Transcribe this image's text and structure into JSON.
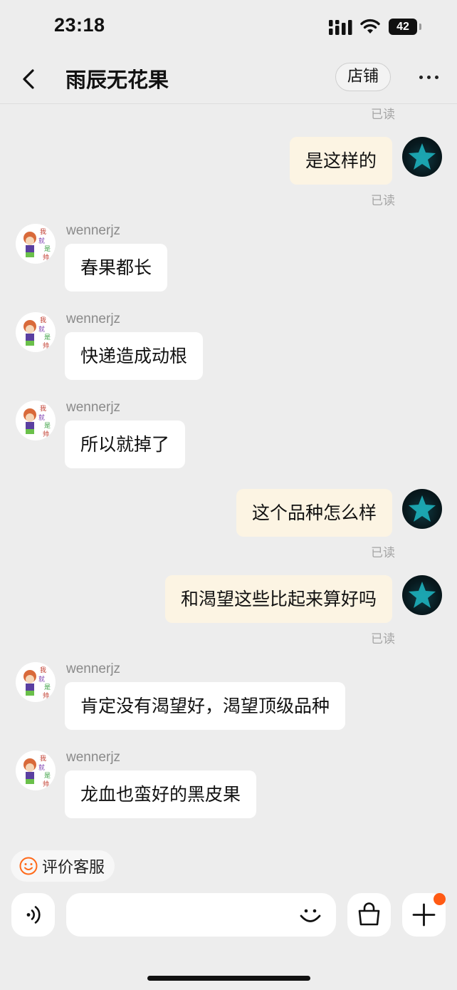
{
  "status_bar": {
    "time": "23:18",
    "battery": "42"
  },
  "header": {
    "title": "雨辰无花果",
    "shop_button": "店铺"
  },
  "read_label": "已读",
  "messages": [
    {
      "direction": "out",
      "text": "是这样的",
      "read": "已读"
    },
    {
      "direction": "in",
      "sender": "wennerjz",
      "text": "春果都长"
    },
    {
      "direction": "in",
      "sender": "wennerjz",
      "text": "快递造成动根"
    },
    {
      "direction": "in",
      "sender": "wennerjz",
      "text": "所以就掉了"
    },
    {
      "direction": "out",
      "text": "这个品种怎么样",
      "read": "已读"
    },
    {
      "direction": "out",
      "text": "和渴望这些比起来算好吗",
      "read": "已读"
    },
    {
      "direction": "in",
      "sender": "wennerjz",
      "text": "肯定没有渴望好，渴望顶级品种"
    },
    {
      "direction": "in",
      "sender": "wennerjz",
      "text": "龙血也蛮好的黑皮果"
    }
  ],
  "rate_chip": {
    "label": "评价客服"
  },
  "input": {
    "placeholder": "",
    "value": ""
  },
  "colors": {
    "outgoing_bubble": "#fcf4e3",
    "incoming_bubble": "#ffffff",
    "background": "#ededed",
    "notify_dot": "#ff5a14"
  }
}
